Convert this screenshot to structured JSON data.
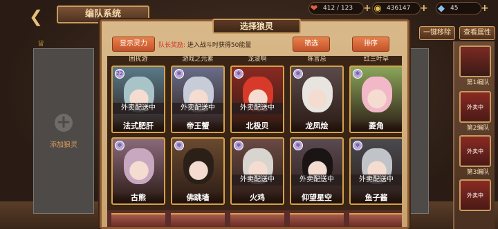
{
  "header": {
    "back_icon": "back-arrow-icon",
    "title": "编队系统"
  },
  "resources": {
    "stamina": {
      "icon": "heart-icon",
      "value": "412 / 123",
      "color": "#e0604a"
    },
    "gold": {
      "icon": "coin-icon",
      "value": "436147",
      "color": "#e6b84a"
    },
    "gems": {
      "icon": "crystal-icon",
      "value": "45",
      "color": "#8ac0e8"
    }
  },
  "actions": {
    "remove_all": "一键移除",
    "view_attributes": "查看属性"
  },
  "left_slot": {
    "add_label": "添加狼灵"
  },
  "team_list": [
    {
      "label": "第1编队",
      "status": ""
    },
    {
      "label": "第2编队",
      "status": "外卖中"
    },
    {
      "label": "第3编队",
      "status": "外卖中"
    },
    {
      "label": "",
      "status": "外卖中"
    }
  ],
  "modal": {
    "title": "选择狼灵",
    "show_power_button": "显示灵力",
    "captain_label": "队长奖励:",
    "captain_text": "进入战斗时获得50能量",
    "filter_button": "筛选",
    "sort_button": "排序"
  },
  "top_partial_names": [
    "困扰游",
    "游戏之元素",
    "龙波啊",
    "陈言忌",
    "红三叶草"
  ],
  "cards_row1": [
    {
      "name": "法式肥肝",
      "status": "外卖配送中",
      "badge": "22",
      "hair": "#a8c4c8",
      "bg": "#5a7a8a"
    },
    {
      "name": "帝王蟹",
      "status": "外卖配送中",
      "badge": "",
      "hair": "#c8ccd8",
      "bg": "#6a6e8a"
    },
    {
      "name": "北极贝",
      "status": "外卖配送中",
      "badge": "",
      "hair": "#d83a2a",
      "bg": "#8a2a22"
    },
    {
      "name": "龙凤烩",
      "status": "",
      "badge": "",
      "hair": "#e8e4e0",
      "bg": "#5a4a4a"
    },
    {
      "name": "菱角",
      "status": "",
      "badge": "",
      "hair": "#f2b8c8",
      "bg": "#8aa65a"
    }
  ],
  "cards_row2": [
    {
      "name": "古熊",
      "status": "",
      "badge": "",
      "hair": "#c8a8c0",
      "bg": "#8a6a7a"
    },
    {
      "name": "佛跳墙",
      "status": "",
      "badge": "",
      "hair": "#2a2018",
      "bg": "#6a4a30"
    },
    {
      "name": "火鸡",
      "status": "外卖配送中",
      "badge": "",
      "hair": "#d8d4d0",
      "bg": "#6a4a44"
    },
    {
      "name": "仰望星空",
      "status": "外卖配送中",
      "badge": "",
      "hair": "#1a1414",
      "bg": "#5a4a52"
    },
    {
      "name": "鱼子酱",
      "status": "外卖配送中",
      "badge": "",
      "hair": "#c0c4c8",
      "bg": "#4a4a50"
    }
  ]
}
